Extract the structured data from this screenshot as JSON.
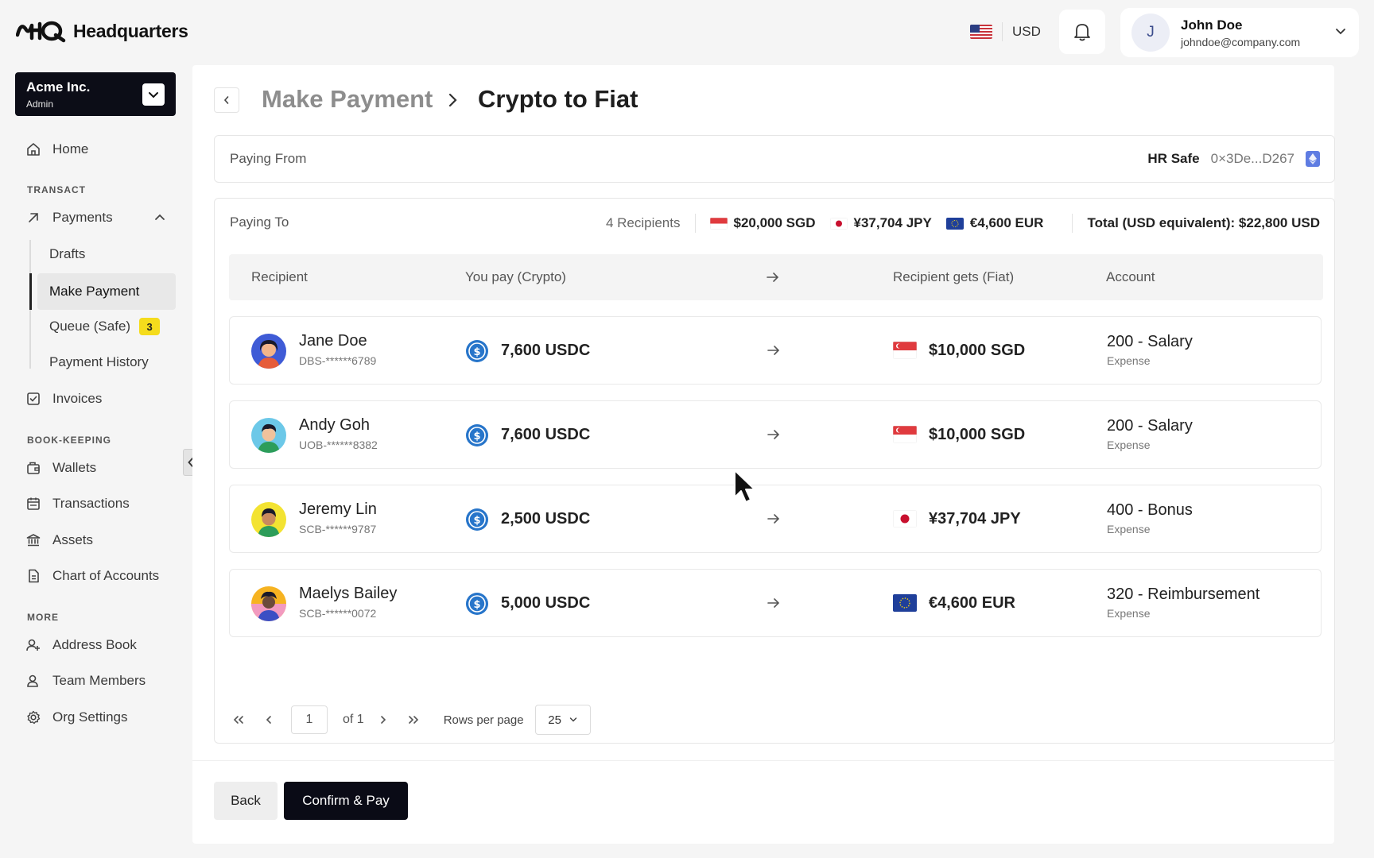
{
  "app": {
    "logo_text": "Headquarters"
  },
  "header": {
    "currency": "USD",
    "user": {
      "initial": "J",
      "name": "John Doe",
      "email": "johndoe@company.com"
    }
  },
  "sidebar": {
    "org": {
      "name": "Acme Inc.",
      "role": "Admin"
    },
    "home": "Home",
    "section_transact": "TRANSACT",
    "payments": "Payments",
    "sub": {
      "drafts": "Drafts",
      "make_payment": "Make Payment",
      "queue": "Queue (Safe)",
      "queue_count": "3",
      "history": "Payment History"
    },
    "invoices": "Invoices",
    "section_bookkeeping": "BOOK-KEEPING",
    "wallets": "Wallets",
    "transactions": "Transactions",
    "assets": "Assets",
    "chart_of_accounts": "Chart of Accounts",
    "section_more": "MORE",
    "address_book": "Address Book",
    "team_members": "Team Members",
    "org_settings": "Org Settings"
  },
  "breadcrumb": {
    "parent": "Make Payment",
    "current": "Crypto to Fiat"
  },
  "paying_from": {
    "label": "Paying From",
    "safe_name": "HR Safe",
    "address": "0×3De...D267"
  },
  "paying_to": {
    "label": "Paying To",
    "recipients_count": "4 Recipients",
    "totals": [
      {
        "flag": "sg",
        "amount": "$20,000 SGD"
      },
      {
        "flag": "jp",
        "amount": "¥37,704 JPY"
      },
      {
        "flag": "eu",
        "amount": "€4,600 EUR"
      }
    ],
    "total_usd": "Total (USD equivalent): $22,800 USD"
  },
  "table": {
    "headers": {
      "recipient": "Recipient",
      "you_pay": "You pay (Crypto)",
      "recipient_gets": "Recipient gets (Fiat)",
      "account": "Account"
    },
    "rows": [
      {
        "name": "Jane Doe",
        "bank": "DBS-******6789",
        "pay": "7,600 USDC",
        "flag": "sg",
        "gets": "$10,000 SGD",
        "account": "200 - Salary",
        "account_type": "Expense",
        "avatar_bg": "#3f5bd6"
      },
      {
        "name": "Andy Goh",
        "bank": "UOB-******8382",
        "pay": "7,600 USDC",
        "flag": "sg",
        "gets": "$10,000 SGD",
        "account": "200 - Salary",
        "account_type": "Expense",
        "avatar_bg": "#6cc8e8"
      },
      {
        "name": "Jeremy Lin",
        "bank": "SCB-******9787",
        "pay": "2,500 USDC",
        "flag": "jp",
        "gets": "¥37,704 JPY",
        "account": "400 - Bonus",
        "account_type": "Expense",
        "avatar_bg": "#f3e332"
      },
      {
        "name": "Maelys Bailey",
        "bank": "SCB-******0072",
        "pay": "5,000 USDC",
        "flag": "eu",
        "gets": "€4,600 EUR",
        "account": "320 - Reimbursement",
        "account_type": "Expense",
        "avatar_bg": "#f6b321"
      }
    ]
  },
  "pagination": {
    "page": "1",
    "of_label": "of 1",
    "rows_label": "Rows per page",
    "rows_value": "25"
  },
  "actions": {
    "back": "Back",
    "confirm": "Confirm & Pay"
  },
  "colors": {
    "primary_dark": "#0a0b16",
    "badge_yellow": "#f5dc1c",
    "usdc_blue": "#2775ca",
    "eth_blue": "#5e7ce2"
  }
}
